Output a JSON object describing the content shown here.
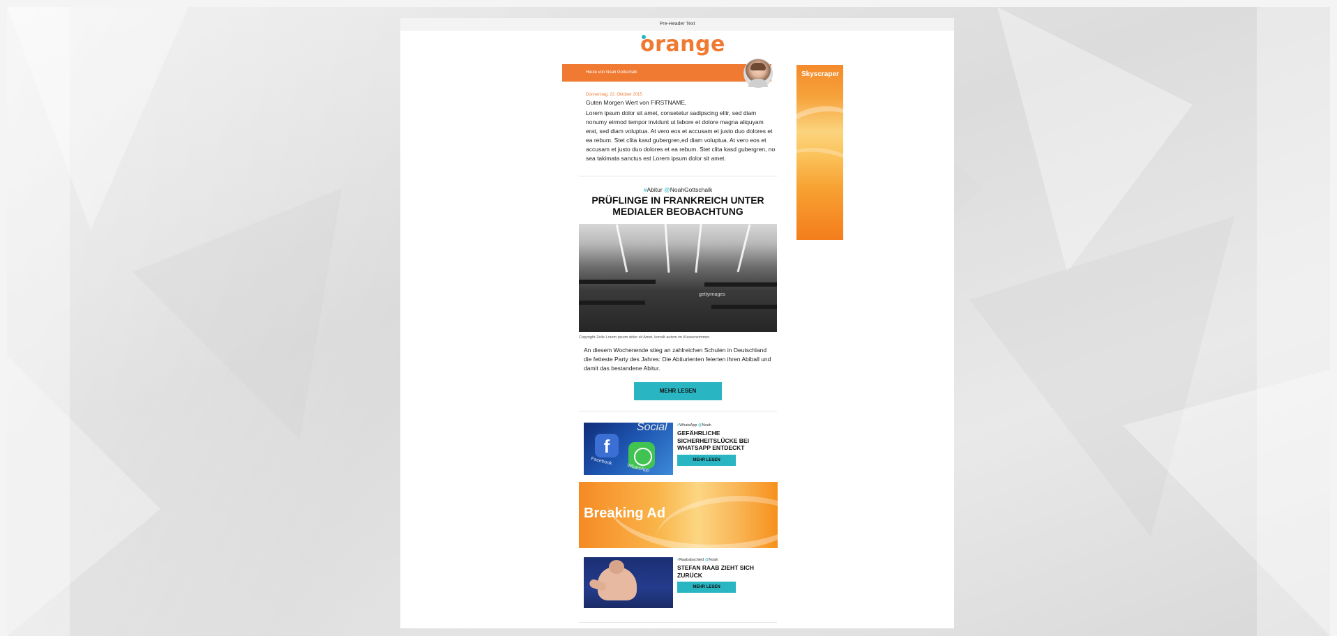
{
  "preheader": "Pre-Header Text",
  "logo_text": "orange",
  "header": {
    "byline": "Heute von Noah Gottschalk"
  },
  "skyscraper": {
    "label": "Skyscraper"
  },
  "intro": {
    "date": "Donnerstag, 22. Oktober 2015",
    "greeting": "Guten Morgen Wert von FIRSTNAME,",
    "body": "Lorem ipsum dolor sit amet, consetetur sadipscing elitr, sed diam nonumy eirmod tempor invidunt ut labore et dolore magna aliquyam erat, sed diam voluptua. At vero eos et accusam et justo duo dolores et ea rebum. Stet clita kasd gubergren,ed diam voluptua. At vero eos et accusam et justo duo dolores et ea rebum. Stet clita kasd gubergren, no sea takimata sanctus est Lorem ipsum dolor sit amet."
  },
  "main_article": {
    "tag_hash_symbol": "#",
    "tag_hash": "Abitur",
    "tag_at_symbol": "@",
    "tag_at": "NoahGottschalk",
    "headline": "Prüflinge in Frankreich unter medialer Beobachtung",
    "image_watermark": "gettyimages",
    "caption": "Copyright Zeile Lorem ipsum dolor sit Amet, konsilt autem im Klassenzimmer.",
    "teaser": "An diesem Wochenende stieg an zahlreichen Schulen in Deutschland die fetteste Party des Jahres: Die Abiturienten feierten ihren Abiball und damit das bestandene Abitur.",
    "button": "Mehr lesen"
  },
  "article_2": {
    "tag_hash_symbol": "#",
    "tag_hash": "WhatsApp",
    "tag_at_symbol": "@",
    "tag_at": "Noah",
    "title": "Gefährliche Sicherheitslücke bei WhatsApp entdeckt",
    "button": "Mehr lesen",
    "image_text_social": "Social",
    "image_text_fb": "Facebook",
    "image_text_wa": "WhatsApp",
    "image_fb_letter": "f"
  },
  "breaking_ad": {
    "label": "Breaking Ad"
  },
  "article_3": {
    "tag_hash_symbol": "#",
    "tag_hash": "Raababschied",
    "tag_at_symbol": "@",
    "tag_at": "Noah",
    "title": "Stefan Raab zieht sich zurück",
    "button": "Mehr lesen"
  },
  "colors": {
    "accent_orange": "#f07a32",
    "accent_teal": "#29b5c2"
  }
}
